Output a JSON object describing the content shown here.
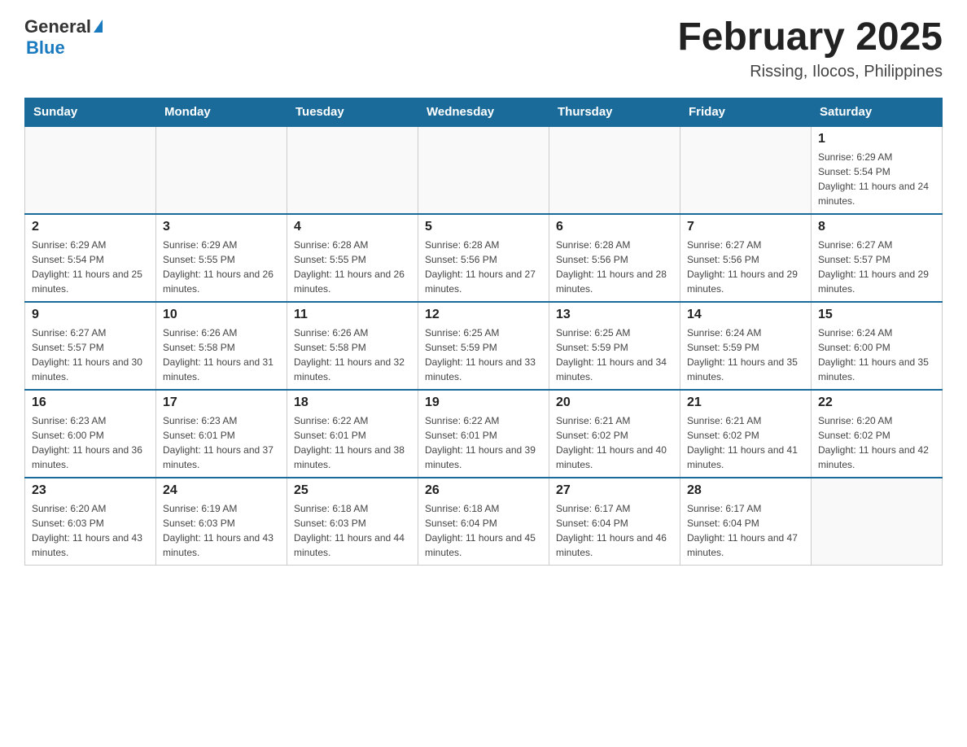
{
  "header": {
    "logo_general": "General",
    "logo_blue": "Blue",
    "month_title": "February 2025",
    "location": "Rissing, Ilocos, Philippines"
  },
  "calendar": {
    "days_of_week": [
      "Sunday",
      "Monday",
      "Tuesday",
      "Wednesday",
      "Thursday",
      "Friday",
      "Saturday"
    ],
    "weeks": [
      [
        {
          "day": "",
          "info": ""
        },
        {
          "day": "",
          "info": ""
        },
        {
          "day": "",
          "info": ""
        },
        {
          "day": "",
          "info": ""
        },
        {
          "day": "",
          "info": ""
        },
        {
          "day": "",
          "info": ""
        },
        {
          "day": "1",
          "info": "Sunrise: 6:29 AM\nSunset: 5:54 PM\nDaylight: 11 hours and 24 minutes."
        }
      ],
      [
        {
          "day": "2",
          "info": "Sunrise: 6:29 AM\nSunset: 5:54 PM\nDaylight: 11 hours and 25 minutes."
        },
        {
          "day": "3",
          "info": "Sunrise: 6:29 AM\nSunset: 5:55 PM\nDaylight: 11 hours and 26 minutes."
        },
        {
          "day": "4",
          "info": "Sunrise: 6:28 AM\nSunset: 5:55 PM\nDaylight: 11 hours and 26 minutes."
        },
        {
          "day": "5",
          "info": "Sunrise: 6:28 AM\nSunset: 5:56 PM\nDaylight: 11 hours and 27 minutes."
        },
        {
          "day": "6",
          "info": "Sunrise: 6:28 AM\nSunset: 5:56 PM\nDaylight: 11 hours and 28 minutes."
        },
        {
          "day": "7",
          "info": "Sunrise: 6:27 AM\nSunset: 5:56 PM\nDaylight: 11 hours and 29 minutes."
        },
        {
          "day": "8",
          "info": "Sunrise: 6:27 AM\nSunset: 5:57 PM\nDaylight: 11 hours and 29 minutes."
        }
      ],
      [
        {
          "day": "9",
          "info": "Sunrise: 6:27 AM\nSunset: 5:57 PM\nDaylight: 11 hours and 30 minutes."
        },
        {
          "day": "10",
          "info": "Sunrise: 6:26 AM\nSunset: 5:58 PM\nDaylight: 11 hours and 31 minutes."
        },
        {
          "day": "11",
          "info": "Sunrise: 6:26 AM\nSunset: 5:58 PM\nDaylight: 11 hours and 32 minutes."
        },
        {
          "day": "12",
          "info": "Sunrise: 6:25 AM\nSunset: 5:59 PM\nDaylight: 11 hours and 33 minutes."
        },
        {
          "day": "13",
          "info": "Sunrise: 6:25 AM\nSunset: 5:59 PM\nDaylight: 11 hours and 34 minutes."
        },
        {
          "day": "14",
          "info": "Sunrise: 6:24 AM\nSunset: 5:59 PM\nDaylight: 11 hours and 35 minutes."
        },
        {
          "day": "15",
          "info": "Sunrise: 6:24 AM\nSunset: 6:00 PM\nDaylight: 11 hours and 35 minutes."
        }
      ],
      [
        {
          "day": "16",
          "info": "Sunrise: 6:23 AM\nSunset: 6:00 PM\nDaylight: 11 hours and 36 minutes."
        },
        {
          "day": "17",
          "info": "Sunrise: 6:23 AM\nSunset: 6:01 PM\nDaylight: 11 hours and 37 minutes."
        },
        {
          "day": "18",
          "info": "Sunrise: 6:22 AM\nSunset: 6:01 PM\nDaylight: 11 hours and 38 minutes."
        },
        {
          "day": "19",
          "info": "Sunrise: 6:22 AM\nSunset: 6:01 PM\nDaylight: 11 hours and 39 minutes."
        },
        {
          "day": "20",
          "info": "Sunrise: 6:21 AM\nSunset: 6:02 PM\nDaylight: 11 hours and 40 minutes."
        },
        {
          "day": "21",
          "info": "Sunrise: 6:21 AM\nSunset: 6:02 PM\nDaylight: 11 hours and 41 minutes."
        },
        {
          "day": "22",
          "info": "Sunrise: 6:20 AM\nSunset: 6:02 PM\nDaylight: 11 hours and 42 minutes."
        }
      ],
      [
        {
          "day": "23",
          "info": "Sunrise: 6:20 AM\nSunset: 6:03 PM\nDaylight: 11 hours and 43 minutes."
        },
        {
          "day": "24",
          "info": "Sunrise: 6:19 AM\nSunset: 6:03 PM\nDaylight: 11 hours and 43 minutes."
        },
        {
          "day": "25",
          "info": "Sunrise: 6:18 AM\nSunset: 6:03 PM\nDaylight: 11 hours and 44 minutes."
        },
        {
          "day": "26",
          "info": "Sunrise: 6:18 AM\nSunset: 6:04 PM\nDaylight: 11 hours and 45 minutes."
        },
        {
          "day": "27",
          "info": "Sunrise: 6:17 AM\nSunset: 6:04 PM\nDaylight: 11 hours and 46 minutes."
        },
        {
          "day": "28",
          "info": "Sunrise: 6:17 AM\nSunset: 6:04 PM\nDaylight: 11 hours and 47 minutes."
        },
        {
          "day": "",
          "info": ""
        }
      ]
    ]
  }
}
